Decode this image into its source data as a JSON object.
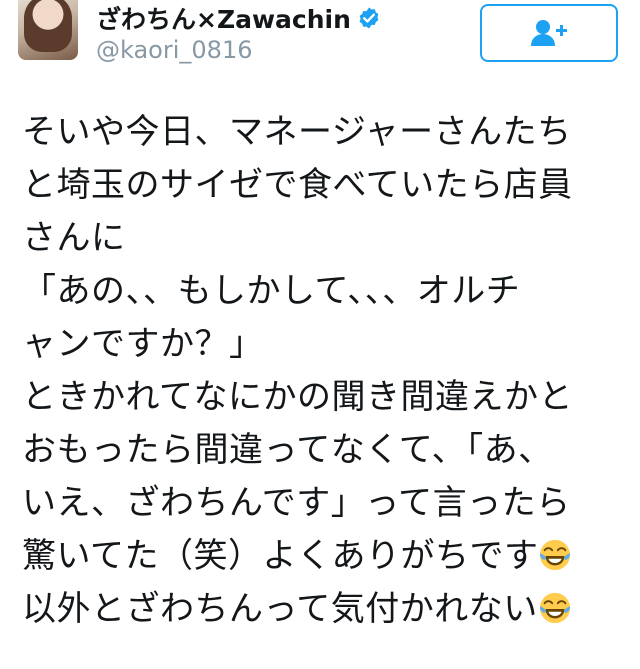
{
  "user": {
    "display_name": "ざわちん×Zawachin",
    "handle": "@kaori_0816",
    "verified": true,
    "avatar_icon": "profile-photo"
  },
  "follow_button": {
    "icon": "add-user-icon",
    "accent_color": "#1da1f2"
  },
  "tweet": {
    "lines": [
      "そいや今日、マネージャーさんたち",
      "と埼玉のサイゼで食べていたら店員",
      "さんに",
      "「あの、、もしかして、、、オルチ",
      "ャンですか？」",
      "ときかれてなにかの聞き間違えかと",
      "おもったら間違ってなくて、「あ、",
      "いえ、ざわちんです」って言ったら",
      "驚いてた（笑）よくありがちです",
      "以外とざわちんって気付かれない"
    ],
    "emoji": "face-with-tears-of-joy-icon"
  }
}
